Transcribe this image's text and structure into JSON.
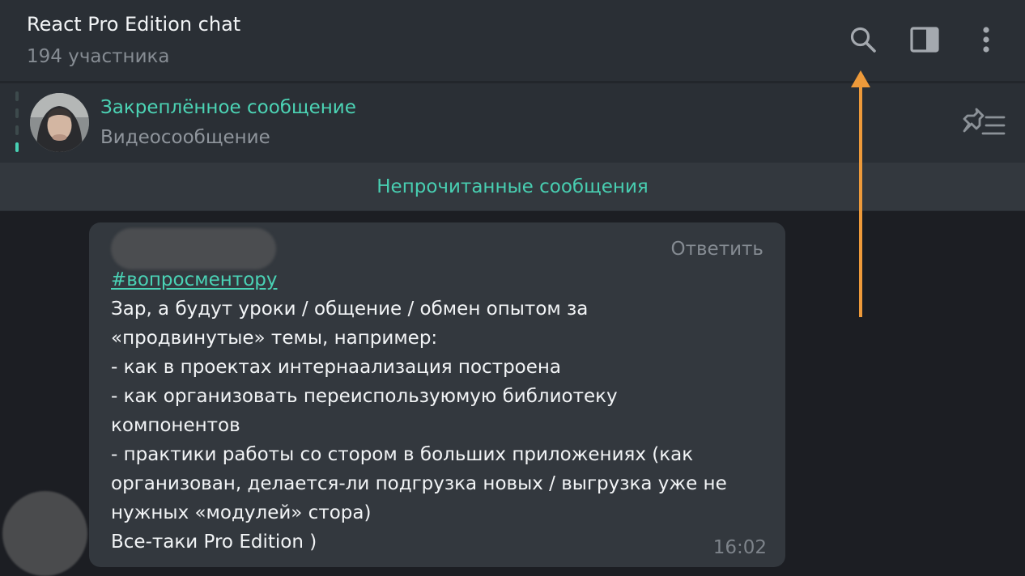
{
  "header": {
    "title": "React Pro Edition chat",
    "subtitle": "194 участника",
    "icons": {
      "search": "search-icon",
      "panel": "sidebar-panel-icon",
      "more": "more-vertical-icon"
    }
  },
  "pinned": {
    "title": "Закреплённое сообщение",
    "text": "Видеосообщение",
    "icon": "pin-list-icon",
    "ticks_total": 4,
    "active_tick": 4
  },
  "unread": {
    "label": "Непрочитанные сообщения"
  },
  "message": {
    "reply_label": "Ответить",
    "hashtag": "#вопросментору",
    "lines": [
      "Зар, а будут уроки / общение / обмен опытом за",
      "«продвинутые» темы, например:",
      "- как в проектах интернаализация построена",
      "- как организовать переиспользуюмую библиотеку",
      "компонентов",
      "- практики работы со стором в больших приложениях (как",
      "организован, делается-ли подгрузка новых / выгрузка уже не",
      "нужных «модулей» стора)",
      "Все-таки Pro Edition )"
    ],
    "time": "16:02"
  },
  "colors": {
    "header_bg": "#2a2f35",
    "chat_bg": "#1c1e23",
    "bubble_bg": "#33383e",
    "accent": "#48d1b4",
    "annotation": "#ee9a3a"
  }
}
